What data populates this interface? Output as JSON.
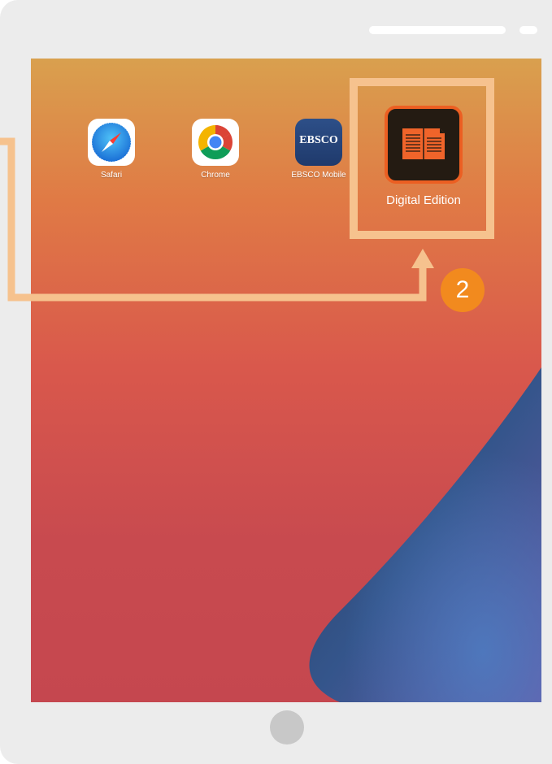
{
  "apps": {
    "safari": {
      "label": "Safari",
      "icon": "safari-compass-icon"
    },
    "chrome": {
      "label": "Chrome",
      "icon": "chrome-icon"
    },
    "ebsco": {
      "label": "EBSCO Mobile",
      "icon": "ebsco-icon",
      "icon_text": "EBSCO"
    },
    "digital_edition": {
      "label": "Digital Edition",
      "icon": "open-book-icon"
    }
  },
  "callout": {
    "step_number": "2",
    "highlight_color": "#f6c28e",
    "badge_color": "#f28a1e",
    "arrow": "arrow-up-icon"
  },
  "colors": {
    "device_frame": "#ececec",
    "home_button": "#c8c8c8",
    "app_accent": "#ec5f22"
  }
}
